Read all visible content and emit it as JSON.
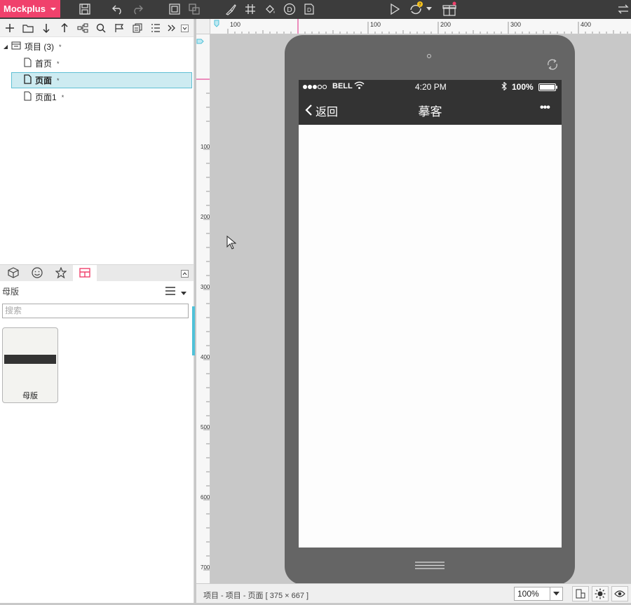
{
  "app": {
    "brand": "Mockplus"
  },
  "tree": {
    "project": {
      "label": "项目 (3)",
      "marker": "*"
    },
    "pages": [
      {
        "label": "首页",
        "marker": "*"
      },
      {
        "label": "页面",
        "marker": "*",
        "selected": true
      },
      {
        "label": "页面1",
        "marker": "*"
      }
    ]
  },
  "library": {
    "header": "母版",
    "search_placeholder": "搜索",
    "masters": [
      {
        "label": "母版"
      }
    ]
  },
  "ruler": {
    "top_labels": [
      "100",
      "100",
      "200",
      "300",
      "400"
    ],
    "left_labels": [
      "100",
      "200",
      "300",
      "400",
      "500",
      "600",
      "700"
    ]
  },
  "device": {
    "status": {
      "carrier": "BELL",
      "time": "4:20 PM",
      "battery": "100%"
    },
    "nav": {
      "back_label": "返回",
      "title": "摹客",
      "more": "•••"
    }
  },
  "bottom": {
    "breadcrumb": "项目 - 项目 - 页面 [ 375 × 667 ]",
    "zoom": "100%"
  },
  "colors": {
    "brand": "#f0416c",
    "accent": "#4fc1d8",
    "toolbar": "#3c3c3c",
    "phone_frame": "#656565",
    "nav_bar": "#333333"
  }
}
